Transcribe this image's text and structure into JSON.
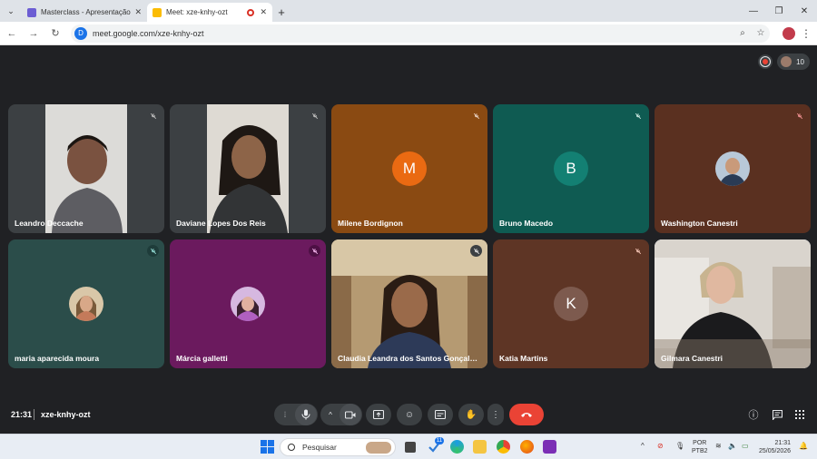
{
  "browser": {
    "tabs": [
      {
        "title": "Masterclass - Apresentação",
        "active": false,
        "favicon_color": "#6c5dd3"
      },
      {
        "title": "Meet: xze-knhy-ozt",
        "active": true,
        "favicon_color": "#fbbc04",
        "recording": true
      }
    ],
    "url": "meet.google.com/xze-knhy-ozt",
    "site_icon_letter": "D"
  },
  "meet": {
    "participant_count": "10",
    "time": "21:31",
    "meeting_code": "xze-knhy-ozt",
    "tiles": [
      {
        "name": "Leandro Deccache",
        "type": "video",
        "bg": "#3c4043",
        "mic_muted": true
      },
      {
        "name": "Daviane Lopes Dos Reis",
        "type": "video",
        "bg": "#3c4043",
        "mic_muted": true
      },
      {
        "name": "Milene Bordignon",
        "type": "initial",
        "initial": "M",
        "bg": "#8a4a12",
        "circle": "#ea6a12",
        "mic_muted": true
      },
      {
        "name": "Bruno Macedo",
        "type": "initial",
        "initial": "B",
        "bg": "#0f5b52",
        "circle": "#138073",
        "mic_muted": true
      },
      {
        "name": "Washington Canestri",
        "type": "avatar",
        "bg": "#5a3020",
        "mic_muted": true
      },
      {
        "name": "maria aparecida moura",
        "type": "avatar",
        "bg": "#2b4d4a",
        "mic_muted": true
      },
      {
        "name": "Márcia galletti",
        "type": "avatar",
        "bg": "#6b1a5e",
        "mic_muted": true
      },
      {
        "name": "Claudia Leandra dos Santos Gonçalves",
        "type": "video",
        "bg": "#5a4a3a",
        "mic_muted": true
      },
      {
        "name": "Katia Martins",
        "type": "initial",
        "initial": "K",
        "bg": "#5e3525",
        "circle": "#7d5a4e",
        "mic_muted": true
      },
      {
        "name": "Gilmara Canestri",
        "type": "video",
        "bg": "#cfcac4",
        "mic_muted": false
      }
    ]
  },
  "taskbar": {
    "search_placeholder": "Pesquisar",
    "notification_count": "11",
    "language_top": "POR",
    "language_bottom": "PTB2",
    "clock_time": "21:31",
    "clock_date": "25/05/2026"
  }
}
